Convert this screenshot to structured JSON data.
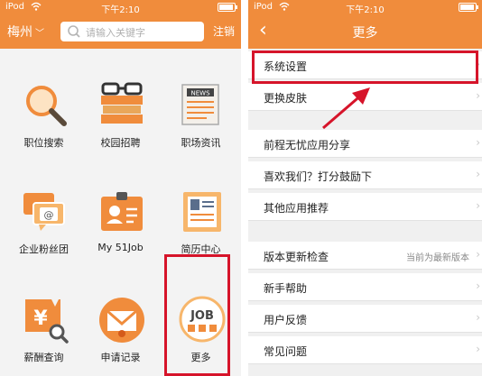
{
  "left": {
    "status": {
      "carrier": "iPod",
      "time": "下午2:10"
    },
    "header": {
      "city": "梅州",
      "search_placeholder": "请输入关键字",
      "logout_label": "注销"
    },
    "grid": [
      {
        "label": "职位搜索",
        "icon": "magnifier-icon"
      },
      {
        "label": "校园招聘",
        "icon": "books-glasses-icon"
      },
      {
        "label": "职场资讯",
        "icon": "newspaper-icon"
      },
      {
        "label": "企业粉丝团",
        "icon": "chat-bubbles-icon"
      },
      {
        "label": "My 51Job",
        "icon": "id-badge-icon"
      },
      {
        "label": "简历中心",
        "icon": "resume-icon"
      },
      {
        "label": "薪酬查询",
        "icon": "salary-icon"
      },
      {
        "label": "申请记录",
        "icon": "envelope-icon"
      },
      {
        "label": "更多",
        "icon": "job-more-icon",
        "icon_text": "JOB"
      }
    ]
  },
  "right": {
    "status": {
      "carrier": "iPod",
      "time": "下午2:10"
    },
    "header": {
      "title": "更多"
    },
    "settings": [
      {
        "label": "系统设置"
      },
      {
        "label": "更换皮肤"
      },
      {
        "label": "前程无忧应用分享"
      },
      {
        "label": "喜欢我们？打分鼓励下"
      },
      {
        "label": "其他应用推荐"
      },
      {
        "label": "版本更新检查",
        "value": "当前为最新版本"
      },
      {
        "label": "新手帮助"
      },
      {
        "label": "用户反馈"
      },
      {
        "label": "常见问题"
      }
    ]
  },
  "colors": {
    "brand_orange": "#f08c3c",
    "highlight_red": "#d6142a"
  }
}
